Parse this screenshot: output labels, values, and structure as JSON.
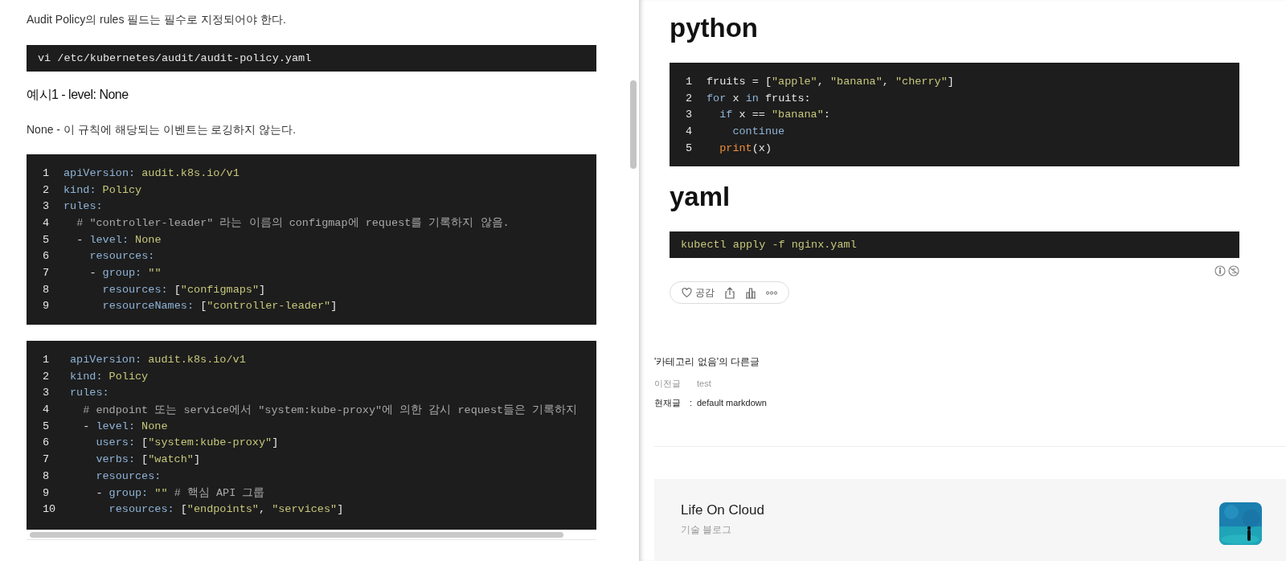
{
  "left": {
    "intro": "Audit Policy의 rules 필드는 필수로 지정되어야 한다.",
    "command": {
      "tokens": [
        {
          "kind": "plain",
          "text": "vi /etc/kubernetes/audit/audit-policy.yaml"
        }
      ]
    },
    "example_heading": "예시1 - level: None",
    "description": "None - 이 규칙에 해당되는 이벤트는 로깅하지 않는다.",
    "code_blocks": [
      {
        "lines": [
          {
            "number": "1",
            "tokens": [
              {
                "kind": "key",
                "text": "apiVersion:"
              },
              {
                "kind": "string",
                "text": " audit.k8s.io/v1"
              }
            ]
          },
          {
            "number": "2",
            "tokens": [
              {
                "kind": "key",
                "text": "kind:"
              },
              {
                "kind": "string",
                "text": " Policy"
              }
            ]
          },
          {
            "number": "3",
            "tokens": [
              {
                "kind": "key",
                "text": "rules:"
              }
            ]
          },
          {
            "number": "4",
            "tokens": [
              {
                "kind": "comment",
                "text": "  # \"controller-leader\" 라는 이름의 configmap에 request를 기록하지 않음."
              }
            ]
          },
          {
            "number": "5",
            "tokens": [
              {
                "kind": "plain",
                "text": "  - "
              },
              {
                "kind": "key",
                "text": "level:"
              },
              {
                "kind": "string",
                "text": " None"
              }
            ]
          },
          {
            "number": "6",
            "tokens": [
              {
                "kind": "key",
                "text": "    resources:"
              }
            ]
          },
          {
            "number": "7",
            "tokens": [
              {
                "kind": "plain",
                "text": "    - "
              },
              {
                "kind": "key",
                "text": "group:"
              },
              {
                "kind": "string",
                "text": " \"\""
              }
            ]
          },
          {
            "number": "8",
            "tokens": [
              {
                "kind": "key",
                "text": "      resources:"
              },
              {
                "kind": "plain",
                "text": " ["
              },
              {
                "kind": "string",
                "text": "\"configmaps\""
              },
              {
                "kind": "plain",
                "text": "]"
              }
            ]
          },
          {
            "number": "9",
            "tokens": [
              {
                "kind": "key",
                "text": "      resourceNames:"
              },
              {
                "kind": "plain",
                "text": " ["
              },
              {
                "kind": "string",
                "text": "\"controller-leader\""
              },
              {
                "kind": "plain",
                "text": "]"
              }
            ]
          }
        ]
      },
      {
        "lines": [
          {
            "number": "1",
            "tokens": [
              {
                "kind": "key",
                "text": "apiVersion:"
              },
              {
                "kind": "string",
                "text": " audit.k8s.io/v1"
              }
            ]
          },
          {
            "number": "2",
            "tokens": [
              {
                "kind": "key",
                "text": "kind:"
              },
              {
                "kind": "string",
                "text": " Policy"
              }
            ]
          },
          {
            "number": "3",
            "tokens": [
              {
                "kind": "key",
                "text": "rules:"
              }
            ]
          },
          {
            "number": "4",
            "tokens": [
              {
                "kind": "comment",
                "text": "  # endpoint 또는 service에서 \"system:kube-proxy\"에 의한 감시 request들은 기록하지"
              }
            ]
          },
          {
            "number": "5",
            "tokens": [
              {
                "kind": "plain",
                "text": "  - "
              },
              {
                "kind": "key",
                "text": "level:"
              },
              {
                "kind": "string",
                "text": " None"
              }
            ]
          },
          {
            "number": "6",
            "tokens": [
              {
                "kind": "key",
                "text": "    users:"
              },
              {
                "kind": "plain",
                "text": " ["
              },
              {
                "kind": "string",
                "text": "\"system:kube-proxy\""
              },
              {
                "kind": "plain",
                "text": "]"
              }
            ]
          },
          {
            "number": "7",
            "tokens": [
              {
                "kind": "key",
                "text": "    verbs:"
              },
              {
                "kind": "plain",
                "text": " ["
              },
              {
                "kind": "string",
                "text": "\"watch\""
              },
              {
                "kind": "plain",
                "text": "]"
              }
            ]
          },
          {
            "number": "8",
            "tokens": [
              {
                "kind": "key",
                "text": "    resources:"
              }
            ]
          },
          {
            "number": "9",
            "tokens": [
              {
                "kind": "plain",
                "text": "    - "
              },
              {
                "kind": "key",
                "text": "group:"
              },
              {
                "kind": "string",
                "text": " \"\""
              },
              {
                "kind": "comment",
                "text": " # 핵심 API 그룹"
              }
            ]
          },
          {
            "number": "10",
            "tokens": [
              {
                "kind": "key",
                "text": "      resources:"
              },
              {
                "kind": "plain",
                "text": " ["
              },
              {
                "kind": "string",
                "text": "\"endpoints\""
              },
              {
                "kind": "plain",
                "text": ", "
              },
              {
                "kind": "string",
                "text": "\"services\""
              },
              {
                "kind": "plain",
                "text": "]"
              }
            ]
          }
        ]
      }
    ]
  },
  "right": {
    "sections": [
      {
        "heading": "python",
        "lines": [
          {
            "number": "1",
            "tokens": [
              {
                "kind": "plain",
                "text": "fruits = ["
              },
              {
                "kind": "string",
                "text": "\"apple\""
              },
              {
                "kind": "plain",
                "text": ", "
              },
              {
                "kind": "string",
                "text": "\"banana\""
              },
              {
                "kind": "plain",
                "text": ", "
              },
              {
                "kind": "string",
                "text": "\"cherry\""
              },
              {
                "kind": "plain",
                "text": "]"
              }
            ]
          },
          {
            "number": "2",
            "tokens": [
              {
                "kind": "keyword",
                "text": "for"
              },
              {
                "kind": "plain",
                "text": " x "
              },
              {
                "kind": "keyword",
                "text": "in"
              },
              {
                "kind": "plain",
                "text": " fruits:"
              }
            ]
          },
          {
            "number": "3",
            "tokens": [
              {
                "kind": "keyword",
                "text": "  if"
              },
              {
                "kind": "plain",
                "text": " x == "
              },
              {
                "kind": "string",
                "text": "\"banana\""
              },
              {
                "kind": "plain",
                "text": ":"
              }
            ]
          },
          {
            "number": "4",
            "tokens": [
              {
                "kind": "keyword",
                "text": "    continue"
              }
            ]
          },
          {
            "number": "5",
            "tokens": [
              {
                "kind": "builtin",
                "text": "  print"
              },
              {
                "kind": "plain",
                "text": "(x)"
              }
            ]
          }
        ]
      },
      {
        "heading": "yaml",
        "command": {
          "tokens": [
            {
              "kind": "string",
              "text": "kubectl apply -f nginx.yaml"
            }
          ]
        }
      }
    ],
    "reaction": {
      "like_label": "공감"
    },
    "other_posts": {
      "title": "'카테고리 없음'의 다른글",
      "items": [
        {
          "label": "이전글",
          "title": "test",
          "selected": false
        },
        {
          "label": "현재글",
          "separator": ":",
          "title": "default markdown",
          "selected": true
        }
      ]
    },
    "blog_card": {
      "name": "Life On Cloud",
      "subtitle": "기술 블로그"
    }
  }
}
